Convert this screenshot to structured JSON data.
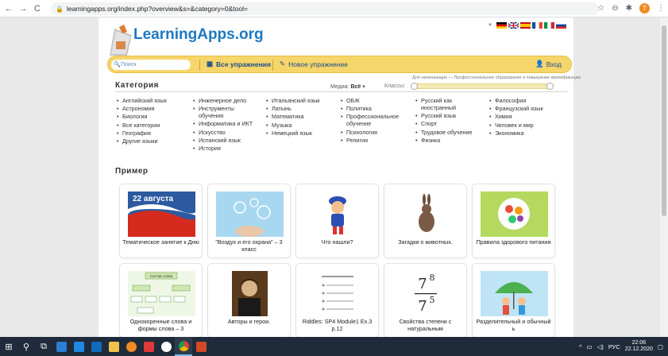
{
  "browser": {
    "url": "learningapps.org/index.php?overview&s=&category=0&tool=",
    "back": "←",
    "forward": "→",
    "reload": "C",
    "profile_initial": "T"
  },
  "header": {
    "logo_text": "LearningApps.org",
    "search_placeholder": "Поиск",
    "all_exercises": "Все упражнения",
    "new_exercise": "Новое упражнение",
    "login": "Вход"
  },
  "filters": {
    "category_title": "Категория",
    "media_label": "Медиа:",
    "media_value": "Всё",
    "classes_label": "Классы:",
    "level_hint": "Для начинающих — Профессиональное образование и повышение квалификации"
  },
  "categories": {
    "col1": [
      "Английский язык",
      "Астрономия",
      "Биология",
      "Все категории",
      "География",
      "Другие языки"
    ],
    "col2": [
      "Инженерное дело",
      "Инструменты обучения",
      "Информатика и ИКТ",
      "Искусство",
      "Испанский язык",
      "История"
    ],
    "col3": [
      "Итальянский язык",
      "Латынь",
      "Математика",
      "Музыка",
      "Немецкий язык"
    ],
    "col4": [
      "ОБЖ",
      "Политика",
      "Профессиональное обучение",
      "Психология",
      "Религия"
    ],
    "col5": [
      "Русский как иностранный",
      "Русский язык",
      "Спорт",
      "Трудовое обучение",
      "Физика"
    ],
    "col6": [
      "Философия",
      "Французский язык",
      "Химия",
      "Человек и мир",
      "Экономика"
    ]
  },
  "example_title": "Пример",
  "cards": [
    {
      "label": "Тематическое занятие к Дню",
      "thumb_text": "22 августа"
    },
    {
      "label": "\"Воздух и его охрана\" – 3 класс"
    },
    {
      "label": "Что нашли?"
    },
    {
      "label": "Загадки о животных."
    },
    {
      "label": "Правила здорового питания"
    },
    {
      "label": "Однокоренные слова и формы слова – 3",
      "thumb_text": "Состав слова"
    },
    {
      "label": "Авторы и герои."
    },
    {
      "label": "Riddles: SP4 Module1 Ex.3 p.12"
    },
    {
      "label": "Свойства степени с натуральным",
      "thumb_top": "7",
      "thumb_top_exp": "8",
      "thumb_bottom": "7",
      "thumb_bottom_exp": "5"
    },
    {
      "label": "Разделительный и обычный ь"
    }
  ],
  "taskbar": {
    "lang": "РУС",
    "time": "22:06",
    "date": "22.12.2020"
  },
  "colors": {
    "brand": "#1c79c0",
    "topbar": "#f6d56a",
    "taskbar": "#1f2b3a"
  }
}
